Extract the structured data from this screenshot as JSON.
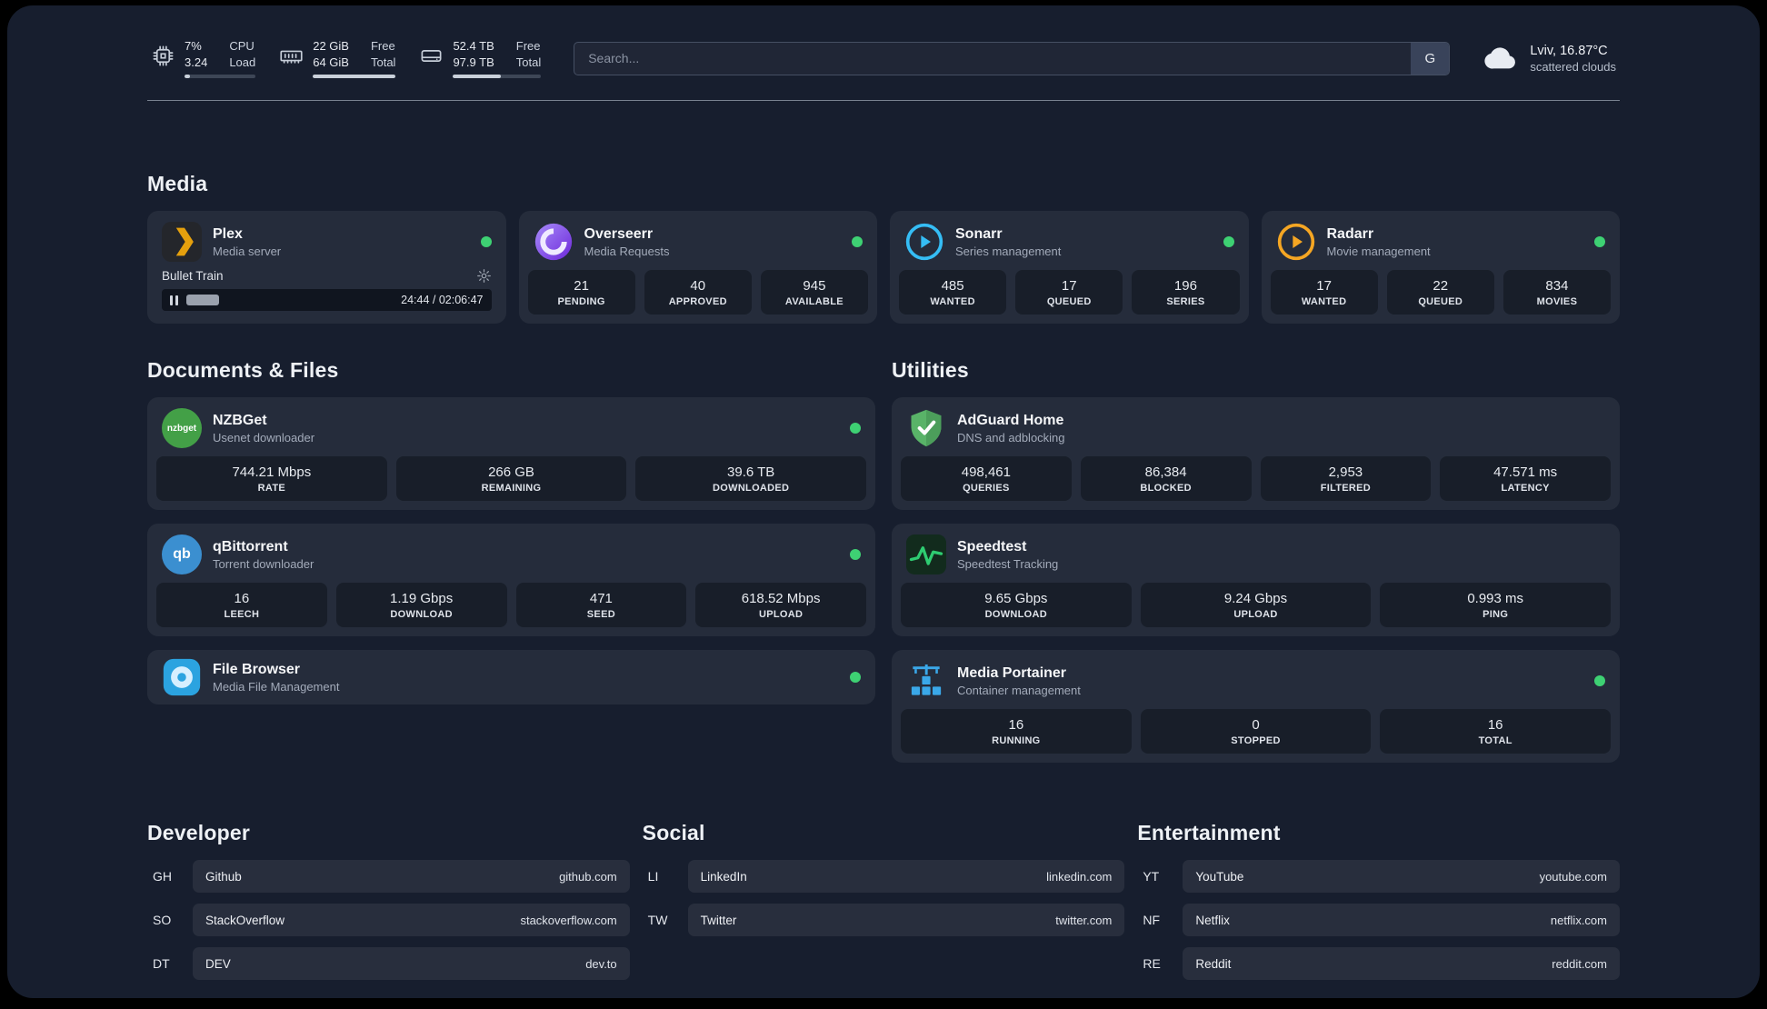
{
  "theme": {
    "accent_green": "#3ed173",
    "background": "#171e2e"
  },
  "topbar": {
    "cpu": {
      "icon": "cpu-icon",
      "values": [
        "7%",
        "3.24"
      ],
      "labels": [
        "CPU",
        "Load"
      ]
    },
    "memory": {
      "icon": "memory-icon",
      "values": [
        "22 GiB",
        "64 GiB"
      ],
      "labels": [
        "Free",
        "Total"
      ]
    },
    "disk": {
      "icon": "disk-icon",
      "values": [
        "52.4 TB",
        "97.9 TB"
      ],
      "labels": [
        "Free",
        "Total"
      ]
    },
    "search": {
      "placeholder": "Search...",
      "provider": "G"
    },
    "weather": {
      "icon": "cloud-icon",
      "location": "Lviv, 16.87°C",
      "condition": "scattered clouds"
    }
  },
  "media": {
    "title": "Media",
    "plex": {
      "name": "Plex",
      "desc": "Media server",
      "now_playing": "Bullet Train",
      "time": "24:44 / 02:06:47"
    },
    "overseerr": {
      "name": "Overseerr",
      "desc": "Media Requests",
      "stats": [
        {
          "value": "21",
          "label": "PENDING"
        },
        {
          "value": "40",
          "label": "APPROVED"
        },
        {
          "value": "945",
          "label": "AVAILABLE"
        }
      ]
    },
    "sonarr": {
      "name": "Sonarr",
      "desc": "Series management",
      "stats": [
        {
          "value": "485",
          "label": "WANTED"
        },
        {
          "value": "17",
          "label": "QUEUED"
        },
        {
          "value": "196",
          "label": "SERIES"
        }
      ]
    },
    "radarr": {
      "name": "Radarr",
      "desc": "Movie management",
      "stats": [
        {
          "value": "17",
          "label": "WANTED"
        },
        {
          "value": "22",
          "label": "QUEUED"
        },
        {
          "value": "834",
          "label": "MOVIES"
        }
      ]
    }
  },
  "documents": {
    "title": "Documents & Files",
    "nzbget": {
      "name": "NZBGet",
      "desc": "Usenet downloader",
      "icon_text": "nzbget",
      "stats": [
        {
          "value": "744.21 Mbps",
          "label": "RATE"
        },
        {
          "value": "266 GB",
          "label": "REMAINING"
        },
        {
          "value": "39.6 TB",
          "label": "DOWNLOADED"
        }
      ]
    },
    "qbittorrent": {
      "name": "qBittorrent",
      "desc": "Torrent downloader",
      "icon_text": "qb",
      "stats": [
        {
          "value": "16",
          "label": "LEECH"
        },
        {
          "value": "1.19 Gbps",
          "label": "DOWNLOAD"
        },
        {
          "value": "471",
          "label": "SEED"
        },
        {
          "value": "618.52 Mbps",
          "label": "UPLOAD"
        }
      ]
    },
    "filebrowser": {
      "name": "File Browser",
      "desc": "Media File Management"
    }
  },
  "utilities": {
    "title": "Utilities",
    "adguard": {
      "name": "AdGuard Home",
      "desc": "DNS and adblocking",
      "stats": [
        {
          "value": "498,461",
          "label": "QUERIES"
        },
        {
          "value": "86,384",
          "label": "BLOCKED"
        },
        {
          "value": "2,953",
          "label": "FILTERED"
        },
        {
          "value": "47.571 ms",
          "label": "LATENCY"
        }
      ]
    },
    "speedtest": {
      "name": "Speedtest",
      "desc": "Speedtest Tracking",
      "stats": [
        {
          "value": "9.65 Gbps",
          "label": "DOWNLOAD"
        },
        {
          "value": "9.24 Gbps",
          "label": "UPLOAD"
        },
        {
          "value": "0.993 ms",
          "label": "PING"
        }
      ]
    },
    "portainer": {
      "name": "Media Portainer",
      "desc": "Container management",
      "stats": [
        {
          "value": "16",
          "label": "RUNNING"
        },
        {
          "value": "0",
          "label": "STOPPED"
        },
        {
          "value": "16",
          "label": "TOTAL"
        }
      ]
    }
  },
  "bookmarks": [
    {
      "title": "Developer",
      "items": [
        {
          "abbr": "GH",
          "name": "Github",
          "url": "github.com"
        },
        {
          "abbr": "SO",
          "name": "StackOverflow",
          "url": "stackoverflow.com"
        },
        {
          "abbr": "DT",
          "name": "DEV",
          "url": "dev.to"
        }
      ]
    },
    {
      "title": "Social",
      "items": [
        {
          "abbr": "LI",
          "name": "LinkedIn",
          "url": "linkedin.com"
        },
        {
          "abbr": "TW",
          "name": "Twitter",
          "url": "twitter.com"
        }
      ]
    },
    {
      "title": "Entertainment",
      "items": [
        {
          "abbr": "YT",
          "name": "YouTube",
          "url": "youtube.com"
        },
        {
          "abbr": "NF",
          "name": "Netflix",
          "url": "netflix.com"
        },
        {
          "abbr": "RE",
          "name": "Reddit",
          "url": "reddit.com"
        }
      ]
    }
  ]
}
